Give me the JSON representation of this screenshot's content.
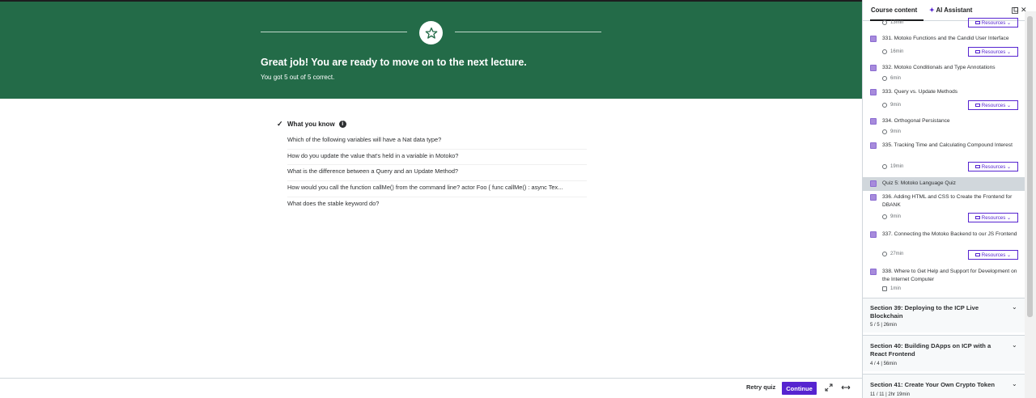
{
  "banner": {
    "title": "Great job! You are ready to move on to the next lecture.",
    "subtitle": "You got 5 out of 5 correct."
  },
  "quiz": {
    "heading": "What you know",
    "questions": [
      "Which of the following variables will have a Nat data type?",
      "How do you update the value that's held in a variable in Motoko?",
      "What is the difference between a Query and an Update Method?",
      "How would you call the function callMe() from the command line? actor Foo { func callMe() : async Tex...",
      "What does the stable keyword do?"
    ]
  },
  "footer": {
    "retry_label": "Retry quiz",
    "continue_label": "Continue"
  },
  "sidebar": {
    "tab_course": "Course content",
    "tab_ai": "AI Assistant",
    "resources_label": "Resources",
    "top_partial": {
      "meta": "13min"
    },
    "lectures": [
      {
        "title": "331. Motoko Functions and the Candid User Interface",
        "meta": "16min",
        "resources": true
      },
      {
        "title": "332. Motoko Conditionals and Type Annotations",
        "meta": "6min",
        "resources": false
      },
      {
        "title": "333. Query vs. Update Methods",
        "meta": "9min",
        "resources": true
      },
      {
        "title": "334. Orthogonal Persistance",
        "meta": "9min",
        "resources": false
      },
      {
        "title": "335. Tracking Time and Calculating Compound Interest",
        "meta": "19min",
        "resources": true
      },
      {
        "title": "Quiz 5: Motoko Language Quiz",
        "meta": "",
        "resources": false,
        "active": true
      },
      {
        "title": "336. Adding HTML and CSS to Create the Frontend for DBANK",
        "meta": "9min",
        "resources": true
      },
      {
        "title": "337. Connecting the Motoko Backend to our JS Frontend",
        "meta": "27min",
        "resources": true
      },
      {
        "title": "338. Where to Get Help and Support for Development on the Internet Computer",
        "meta": "1min",
        "resources": false
      }
    ],
    "sections": [
      {
        "title": "Section 39: Deploying to the ICP Live Blockchain",
        "meta": "5 / 5 | 26min"
      },
      {
        "title": "Section 40: Building DApps on ICP with a React Frontend",
        "meta": "4 / 4 | 56min"
      },
      {
        "title": "Section 41: Create Your Own Crypto Token",
        "meta": "11 / 11 | 2hr 19min"
      }
    ]
  },
  "colors": {
    "banner_green": "#236b48",
    "accent_purple": "#5624d0",
    "checkbox_purple": "#a78bdc"
  }
}
